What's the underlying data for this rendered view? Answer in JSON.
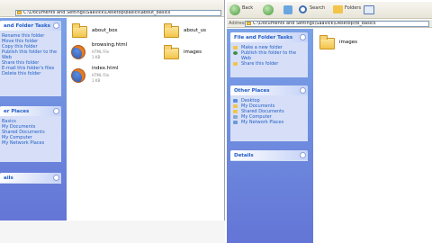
{
  "left_window": {
    "address_path": "C:\\Documents and Settings\\Saavick\\Desktop\\basics\\about_basics",
    "panels": [
      {
        "title": "and Folder Tasks",
        "items": [
          "Rename this folder",
          "Move this folder",
          "Copy this folder",
          "Publish this folder to the",
          "Web",
          "Share this folder",
          "E-mail this folder's files",
          "Delete this folder"
        ]
      },
      {
        "title": "er Places",
        "items": [
          "Basics",
          "My Documents",
          "Shared Documents",
          "My Computer",
          "My Network Places"
        ]
      },
      {
        "title": "ails",
        "items": []
      }
    ],
    "files": [
      {
        "name": "about_box",
        "type": "folder"
      },
      {
        "name": "about_us",
        "type": "folder"
      },
      {
        "name": "browsing.html",
        "meta1": "HTML File",
        "meta2": "1 KB",
        "type": "html"
      },
      {
        "name": "images",
        "type": "folder"
      },
      {
        "name": "index.html",
        "meta1": "HTML File",
        "meta2": "1 KB",
        "type": "html"
      }
    ]
  },
  "right_window": {
    "toolbar": {
      "back": "Back",
      "search": "Search",
      "folders": "Folders"
    },
    "address_label": "Address",
    "address_path": "C:\\Documents and Settings\\Saavick\\Desktop\\fb_basics",
    "panels": [
      {
        "title": "File and Folder Tasks",
        "items": [
          "Make a new folder",
          "Publish this folder to the",
          "Web",
          "Share this folder"
        ]
      },
      {
        "title": "Other Places",
        "items": [
          "Desktop",
          "My Documents",
          "Shared Documents",
          "My Computer",
          "My Network Places"
        ]
      },
      {
        "title": "Details",
        "items": []
      }
    ],
    "files": [
      {
        "name": "images",
        "type": "folder"
      }
    ]
  }
}
